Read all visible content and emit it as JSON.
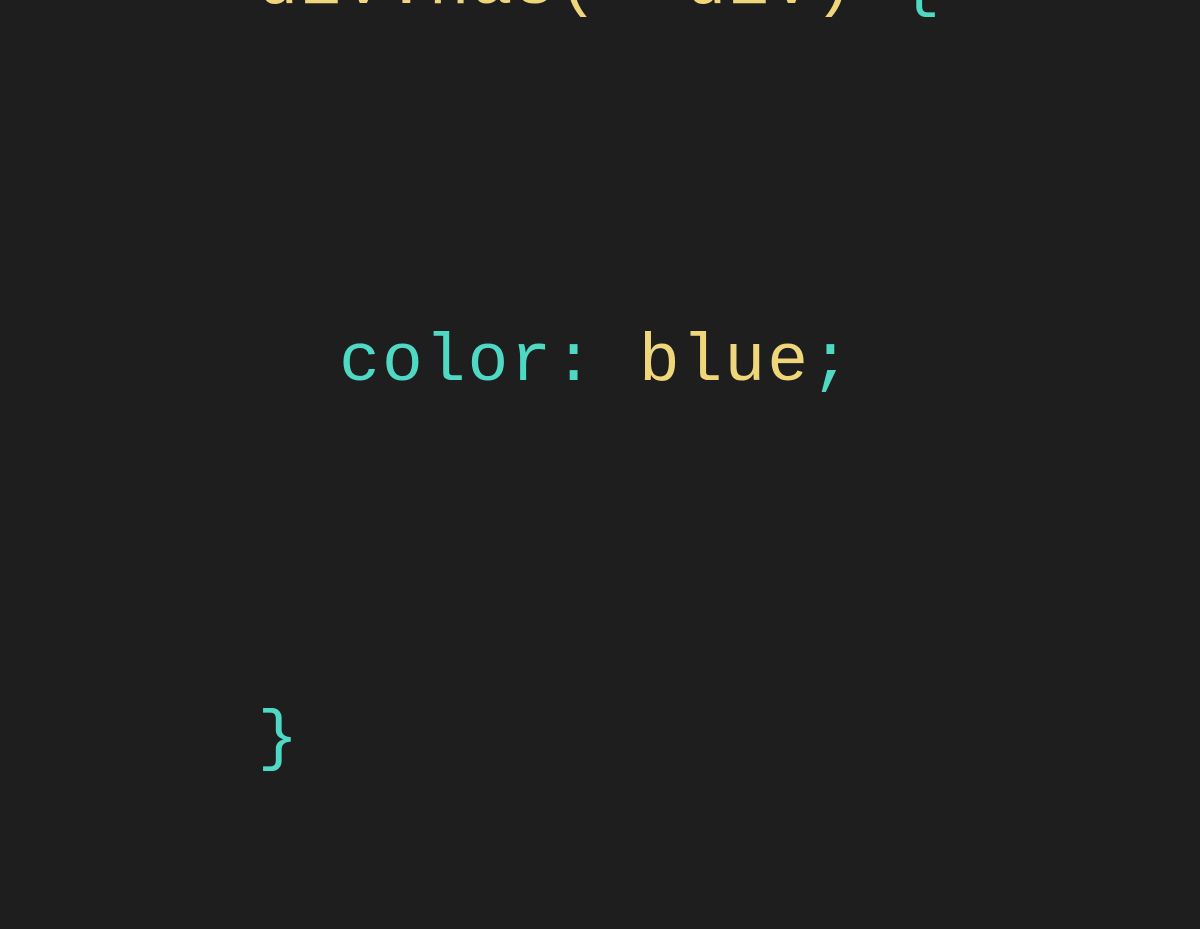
{
  "code": {
    "line1": {
      "selector": "div:has(+ div) ",
      "brace_open": "{"
    },
    "line2": {
      "property": "color",
      "colon": ": ",
      "value": "blue",
      "semicolon": ";"
    },
    "line3": {
      "brace_close": "}"
    }
  }
}
